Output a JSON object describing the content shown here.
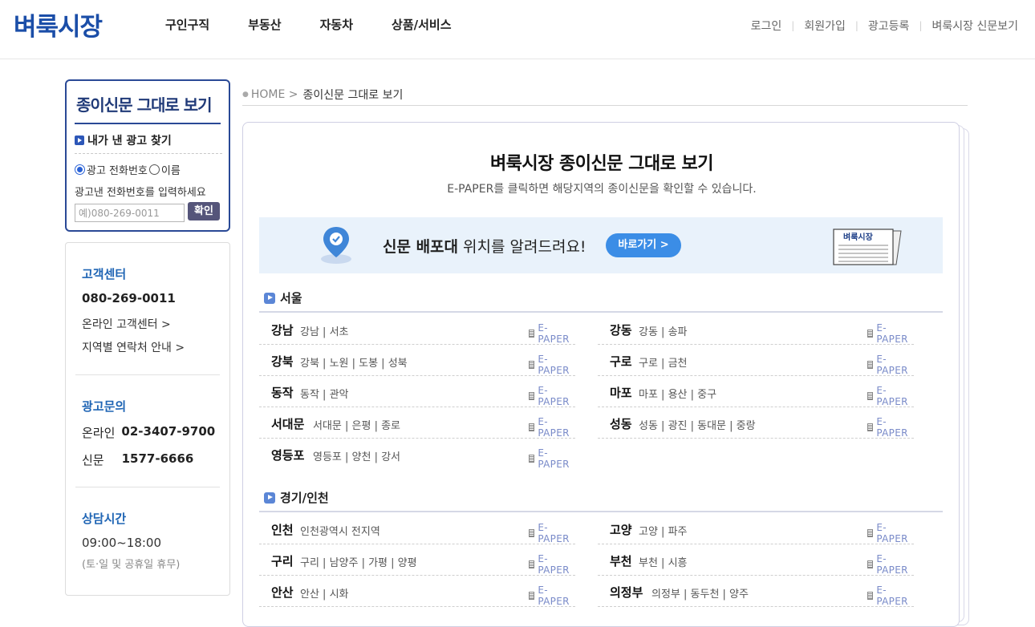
{
  "header": {
    "logo": "벼룩시장",
    "nav": [
      "구인구직",
      "부동산",
      "자동차",
      "상품/서비스"
    ],
    "util": [
      "로그인",
      "회원가입",
      "광고등록",
      "벼룩시장 신문보기"
    ]
  },
  "sidebar": {
    "search": {
      "title": "종이신문 그대로 보기",
      "subtitle": "내가 낸 광고 찾기",
      "radio_phone": "광고 전화번호",
      "radio_name": "이름",
      "help": "광고낸 전화번호를 입력하세요",
      "placeholder": "예)080-269-0011",
      "button": "확인"
    },
    "customer": {
      "center_title": "고객센터",
      "center_phone": "080-269-0011",
      "online_link": "온라인 고객센터 >",
      "region_link": "지역별 연락처 안내 >",
      "ad_title": "광고문의",
      "online_label": "온라인",
      "online_phone": "02-3407-9700",
      "paper_label": "신문",
      "paper_phone": "1577-6666",
      "hours_title": "상담시간",
      "hours": "09:00~18:00",
      "hours_note": "(토·일 및 공휴일 휴무)"
    }
  },
  "breadcrumb": {
    "home": "HOME >",
    "current": "종이신문 그대로 보기"
  },
  "main": {
    "title": "벼룩시장 종이신문 그대로 보기",
    "subtitle": "E-PAPER를 클릭하면 해당지역의 종이신문을 확인할 수 있습니다.",
    "banner": {
      "text_bold": "신문 배포대",
      "text_rest": " 위치를 알려드려요!",
      "button": "바로가기 >",
      "paper_label": "벼룩시장"
    },
    "epaper_label": "E-PAPER",
    "sections": [
      {
        "title": "서울",
        "items": [
          {
            "region": "강남",
            "areas": "강남 | 서초"
          },
          {
            "region": "강동",
            "areas": "강동 | 송파"
          },
          {
            "region": "강북",
            "areas": "강북 | 노원 | 도봉 | 성북"
          },
          {
            "region": "구로",
            "areas": "구로 | 금천"
          },
          {
            "region": "동작",
            "areas": "동작 | 관악"
          },
          {
            "region": "마포",
            "areas": "마포 | 용산 | 중구"
          },
          {
            "region": "서대문",
            "areas": "서대문 | 은평 | 종로"
          },
          {
            "region": "성동",
            "areas": "성동 | 광진 | 동대문 | 중랑"
          },
          {
            "region": "영등포",
            "areas": "영등포 | 양천 | 강서"
          }
        ]
      },
      {
        "title": "경기/인천",
        "items": [
          {
            "region": "인천",
            "areas": "인천광역시 전지역"
          },
          {
            "region": "고양",
            "areas": "고양 | 파주"
          },
          {
            "region": "구리",
            "areas": "구리 | 남양주 | 가평 | 양평"
          },
          {
            "region": "부천",
            "areas": "부천 | 시흥"
          },
          {
            "region": "안산",
            "areas": "안산 | 시화"
          },
          {
            "region": "의정부",
            "areas": "의정부 | 동두천 | 양주"
          }
        ]
      }
    ]
  }
}
